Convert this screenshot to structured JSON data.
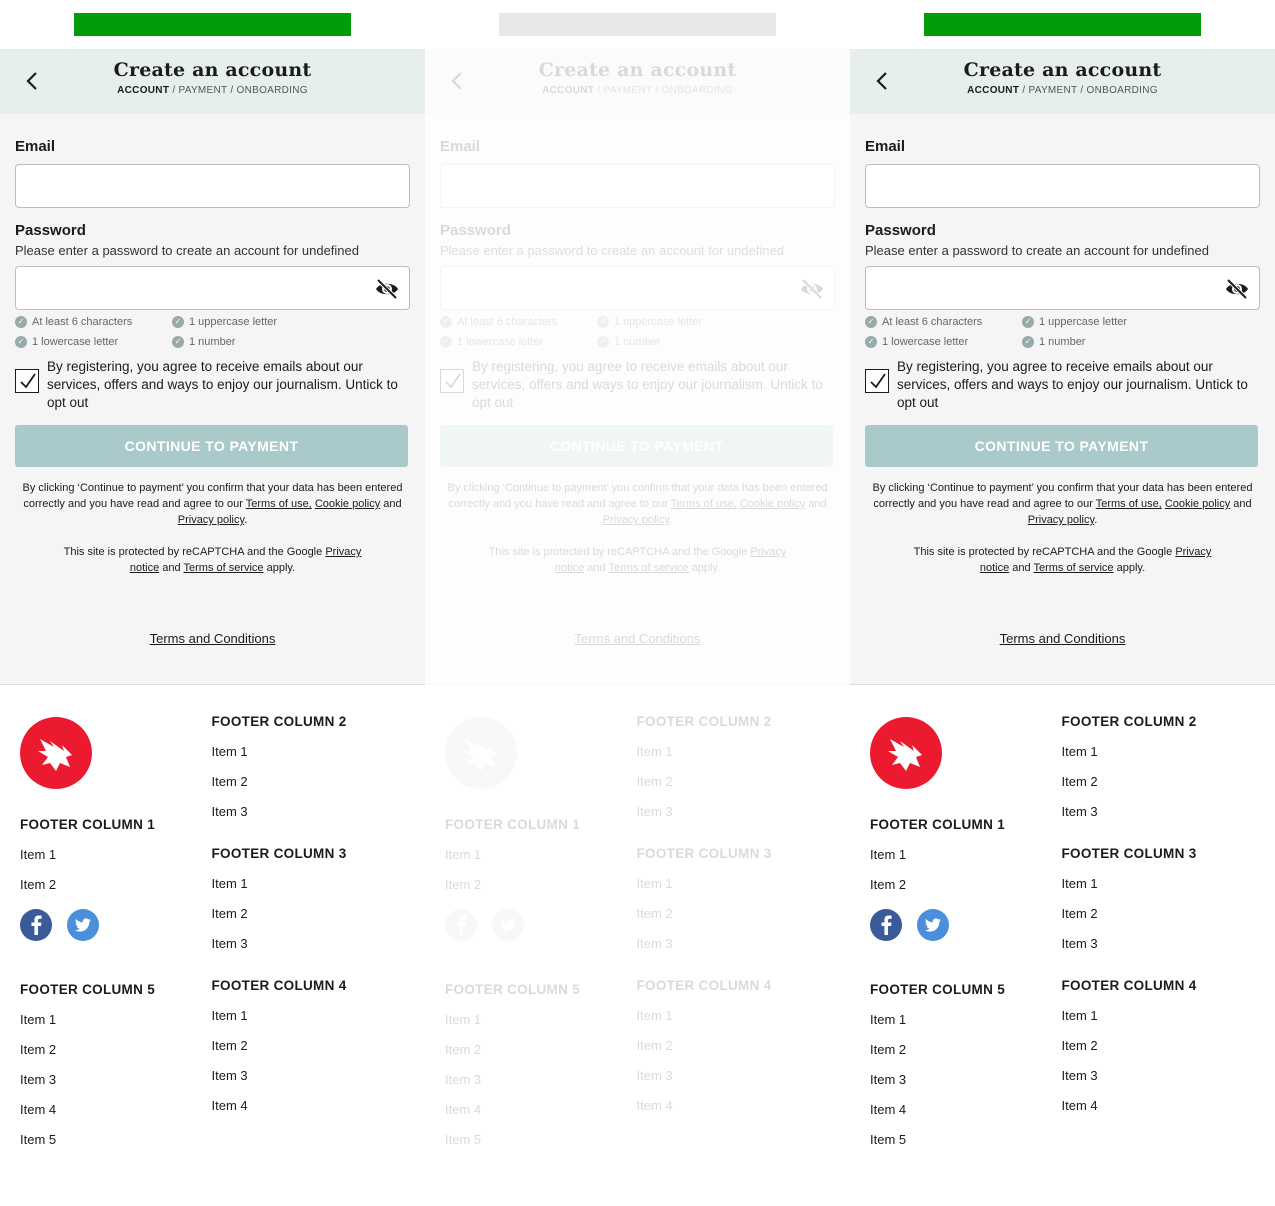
{
  "header": {
    "title": "Create an account",
    "crumb_active": "ACCOUNT",
    "crumb_rest": " / PAYMENT / ONBOARDING"
  },
  "form": {
    "email_label": "Email",
    "password_label": "Password",
    "password_hint": "Please enter a password to create an account for undefined",
    "rules": [
      "At least 6 characters",
      "1 uppercase letter",
      "1 lowercase letter",
      "1 number"
    ],
    "consent": "By registering, you agree to receive emails about our services, offers and ways to enjoy our journalism. Untick to opt out",
    "continue_button": "CONTINUE TO PAYMENT",
    "legal_prefix": "By clicking ‘Continue to payment’ you confirm that your data has been entered correctly and you have read and agree to our ",
    "terms_of_use": "Terms of use,",
    "cookie_policy": "Cookie policy",
    "and": "and",
    "privacy_policy": "Privacy policy",
    "period": ".",
    "recaptcha_prefix": "This site is protected by reCAPTCHA and the Google ",
    "privacy_notice": "Privacy notice",
    "terms_of_service": "Terms of service",
    "apply": "apply.",
    "terms_conditions": "Terms and Conditions"
  },
  "footer": {
    "col1": {
      "heading": "FOOTER COLUMN 1",
      "items": [
        "Item 1",
        "Item 2"
      ]
    },
    "col2": {
      "heading": "FOOTER COLUMN 2",
      "items": [
        "Item 1",
        "Item 2",
        "Item 3"
      ]
    },
    "col3": {
      "heading": "FOOTER COLUMN 3",
      "items": [
        "Item 1",
        "Item 2",
        "Item 3"
      ]
    },
    "col4": {
      "heading": "FOOTER COLUMN 4",
      "items": [
        "Item 1",
        "Item 2",
        "Item 3",
        "Item 4"
      ]
    },
    "col5": {
      "heading": "FOOTER COLUMN 5",
      "items": [
        "Item 1",
        "Item 2",
        "Item 3",
        "Item 4",
        "Item 5"
      ]
    },
    "social": [
      "facebook-icon",
      "twitter-icon"
    ]
  },
  "colors": {
    "top_bar": "#029b0b",
    "header_bg": "#e6efee",
    "button_bg": "#a9c9cb",
    "logo_red": "#ec1a2e",
    "facebook": "#3b5a9a",
    "twitter": "#4a8fdc"
  }
}
